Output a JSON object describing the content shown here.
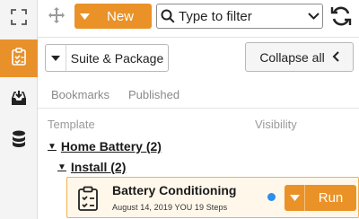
{
  "toolbar": {
    "new_label": "New",
    "filter_placeholder": "Type to filter"
  },
  "actions": {
    "suite_label": "Suite & Package",
    "collapse_label": "Collapse all"
  },
  "tabs": [
    {
      "label": "Bookmarks"
    },
    {
      "label": "Published"
    }
  ],
  "columns": {
    "template": "Template",
    "visibility": "Visibility"
  },
  "tree": {
    "group": "Home Battery (2)",
    "subgroup": "Install (2)"
  },
  "template_item": {
    "name": "Battery Conditioning",
    "meta": "August 14, 2019  YOU  19 Steps",
    "status_color": "#2b8ef0",
    "run_label": "Run"
  },
  "colors": {
    "accent": "#ea9227",
    "rail_active": "#e8912a"
  },
  "icons": {
    "rail": [
      "expand-icon",
      "clipboard-icon",
      "inbox-download-icon",
      "database-icon"
    ],
    "toolbar": [
      "move-icon",
      "search-icon",
      "refresh-icon"
    ]
  }
}
